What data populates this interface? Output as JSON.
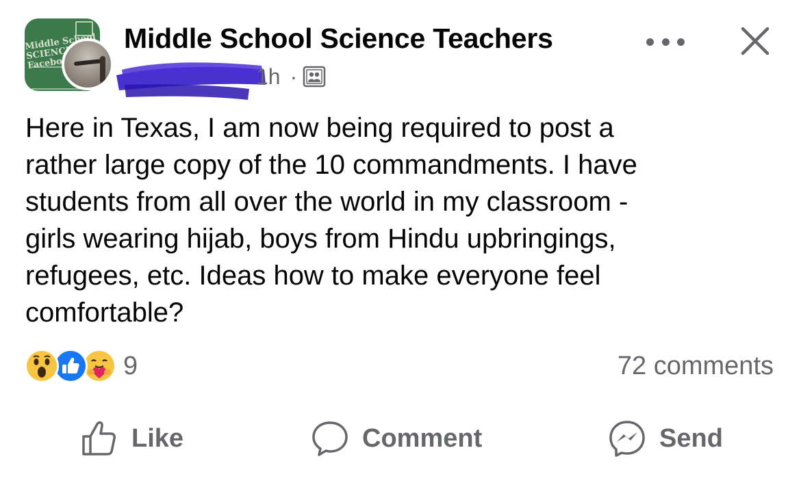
{
  "post": {
    "group_name": "Middle School Science Teachers",
    "group_avatar_text": "Middle School\nSCIENCE TE\nFacebook",
    "time": "1h",
    "separator": "·",
    "audience_icon": "group-members-icon",
    "text": "Here in Texas, I am now being required to post a\nrather large copy of the 10 commandments. I have\nstudents from all over the world in my classroom -\ngirls wearing hijab, boys from Hindu upbringings,\nrefugees, etc. Ideas how to make everyone feel\ncomfortable?",
    "reactions": {
      "icons": [
        "wow-reaction-icon",
        "like-reaction-icon",
        "care-reaction-icon"
      ],
      "count": "9"
    },
    "comments_count": "72 comments"
  },
  "actions": {
    "like": "Like",
    "comment": "Comment",
    "send": "Send"
  },
  "colors": {
    "text_primary": "#050505",
    "text_secondary": "#65676b",
    "like_blue": "#1877f2",
    "wow_yellow": "#f7c542",
    "redaction": "#3a1fc9"
  }
}
